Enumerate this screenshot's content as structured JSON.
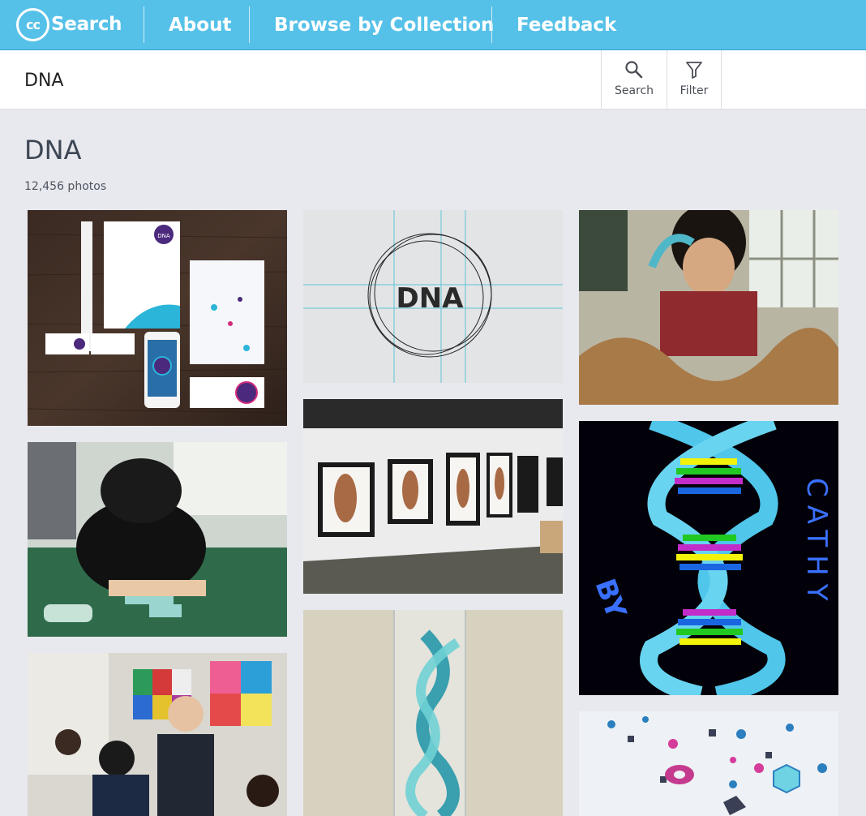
{
  "header": {
    "logo_text": "Search",
    "logo_mark": "cc",
    "nav": [
      {
        "label": "About"
      },
      {
        "label": "Browse by Collection"
      },
      {
        "label": "Feedback"
      }
    ],
    "accent_color": "#56c1e8"
  },
  "search": {
    "query": "DNA",
    "search_label": "Search",
    "filter_label": "Filter",
    "search_icon": "magnifier-icon",
    "filter_icon": "funnel-icon"
  },
  "results": {
    "title": "DNA",
    "count_text": "12,456 photos"
  },
  "photos": [
    {
      "subject": "DNA brand stationery mockup on wood",
      "logo_text": "DNA"
    },
    {
      "subject": "DNA logo construction grid",
      "logo_text": "DNA"
    },
    {
      "subject": "Student building paper double helix model"
    },
    {
      "subject": "Boy building DNA model at table"
    },
    {
      "subject": "Framed photographs on gallery wall"
    },
    {
      "subject": "Colorful double helix illustration",
      "art_text": [
        "CATHY",
        "BY"
      ]
    },
    {
      "subject": "Students with teacher and model in classroom"
    },
    {
      "subject": "Twisted plastic bottle DNA sculpture"
    },
    {
      "subject": "Floating colorful 3D shapes"
    }
  ]
}
